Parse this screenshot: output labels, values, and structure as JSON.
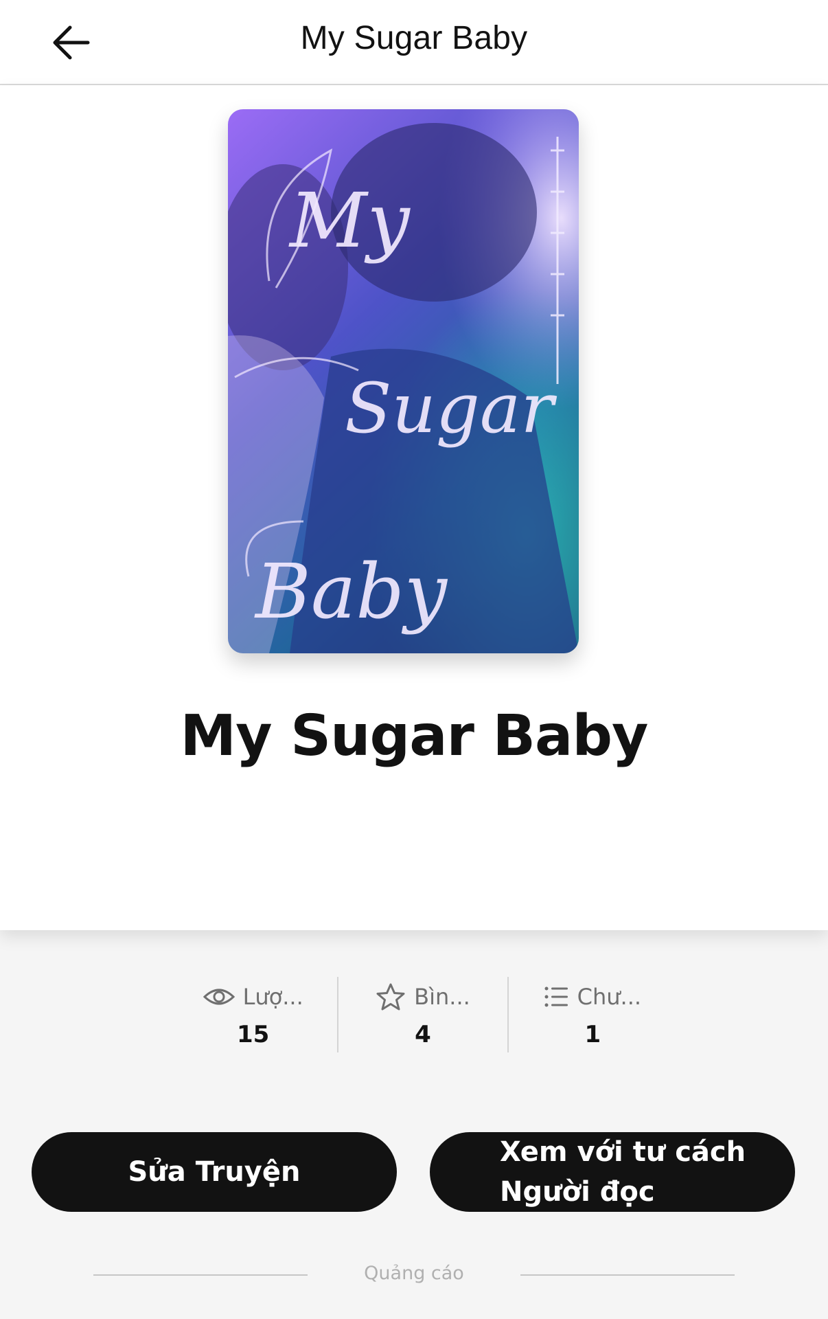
{
  "header": {
    "title": "My Sugar Baby",
    "back_icon": "arrow-left-icon"
  },
  "story": {
    "title": "My Sugar Baby",
    "cover": {
      "lettering": [
        "My",
        "Sugar",
        "Baby"
      ],
      "colors": {
        "top": "#8a5cf0",
        "middle": "#4a5bd0",
        "bottom": "#1f6f9a"
      }
    }
  },
  "stats": [
    {
      "icon": "eye-icon",
      "label": "Lượ...",
      "value": "15"
    },
    {
      "icon": "star-icon",
      "label": "Bìn...",
      "value": "4"
    },
    {
      "icon": "list-icon",
      "label": "Chư...",
      "value": "1"
    }
  ],
  "actions": {
    "edit_label": "Sửa Truyện",
    "reader_line1": "Xem với tư cách",
    "reader_line2": "Người đọc"
  },
  "ad": {
    "label": "Quảng cáo"
  },
  "colors": {
    "button_bg": "#121212",
    "page_bg": "#f5f5f5"
  }
}
